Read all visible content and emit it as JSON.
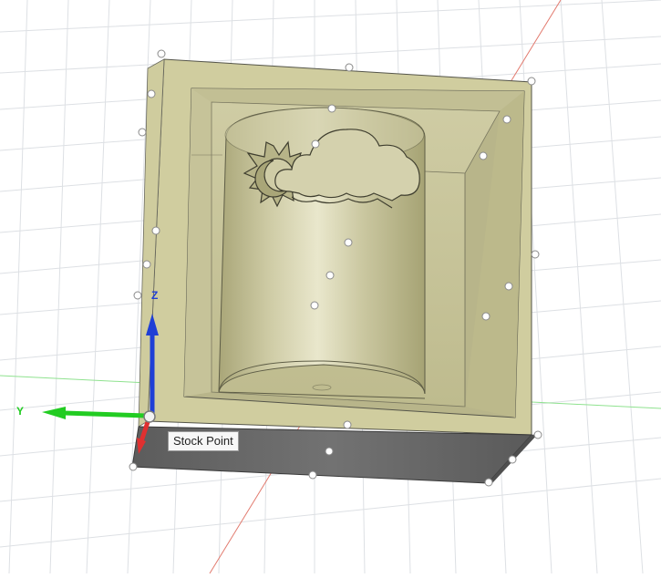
{
  "viewport": {
    "tooltip": "Stock Point",
    "axes": {
      "z_label": "Z",
      "y_label": "Y"
    },
    "colors": {
      "grid": "#d9dde2",
      "x_axis": "#e27a6e",
      "y_axis_line": "#8fe28f",
      "stock_face": "#c8c597",
      "stock_side": "#6b6b6b",
      "model": "#c9c6a0",
      "z_arrow": "#1f3fd6",
      "y_arrow": "#22cc22",
      "x_arrow": "#e03030"
    }
  }
}
